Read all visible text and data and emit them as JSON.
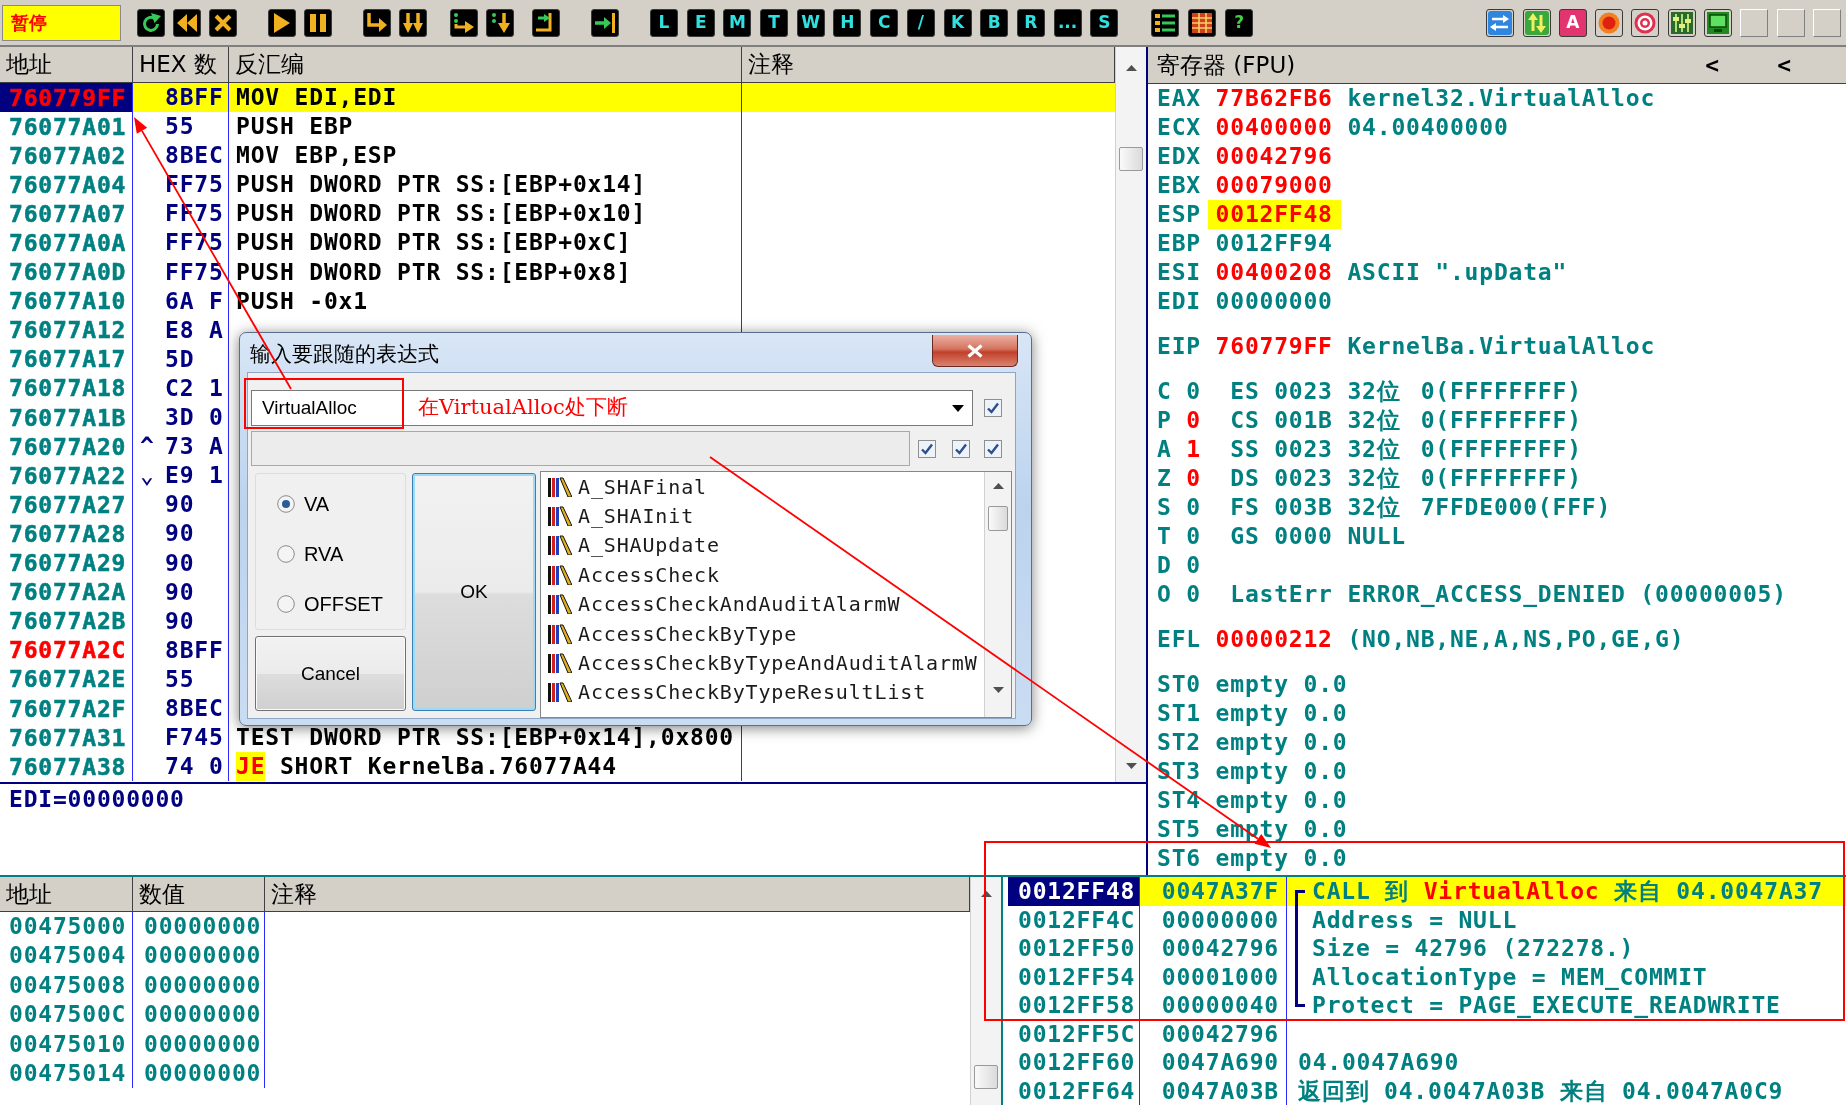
{
  "toolbar": {
    "status": "暂停",
    "letter_buttons": [
      "L",
      "E",
      "M",
      "T",
      "W",
      "H",
      "C",
      "/",
      "K",
      "B",
      "R",
      "...",
      "S"
    ],
    "help_button": "?",
    "text_button": "A"
  },
  "disassembly": {
    "columns": [
      "地址",
      "HEX 数",
      "反汇编",
      "注释"
    ],
    "rows": [
      {
        "address": "760779FF",
        "color": "#ff0000",
        "selected": true,
        "hex": "8BFF",
        "instruction": "MOV EDI,EDI"
      },
      {
        "address": "76077A01",
        "color": "#008080",
        "selected": false,
        "hex": "55",
        "instruction": "PUSH EBP"
      },
      {
        "address": "76077A02",
        "color": "#008080",
        "selected": false,
        "hex": "8BEC",
        "instruction": "MOV EBP,ESP"
      },
      {
        "address": "76077A04",
        "color": "#008080",
        "selected": false,
        "hex": "FF75",
        "instruction": "PUSH DWORD PTR SS:[EBP+0x14]"
      },
      {
        "address": "76077A07",
        "color": "#008080",
        "selected": false,
        "hex": "FF75",
        "instruction": "PUSH DWORD PTR SS:[EBP+0x10]"
      },
      {
        "address": "76077A0A",
        "color": "#008080",
        "selected": false,
        "hex": "FF75",
        "instruction": "PUSH DWORD PTR SS:[EBP+0xC]"
      },
      {
        "address": "76077A0D",
        "color": "#008080",
        "selected": false,
        "hex": "FF75",
        "instruction": "PUSH DWORD PTR SS:[EBP+0x8]"
      },
      {
        "address": "76077A10",
        "color": "#008080",
        "selected": false,
        "hex": "6A F",
        "instruction": "PUSH -0x1"
      },
      {
        "address": "76077A12",
        "color": "#008080",
        "selected": false,
        "hex": "E8 A"
      },
      {
        "address": "76077A17",
        "color": "#008080",
        "selected": false,
        "hex": "5D"
      },
      {
        "address": "76077A18",
        "color": "#008080",
        "selected": false,
        "hex": "C2 1"
      },
      {
        "address": "76077A1B",
        "color": "#008080",
        "selected": false,
        "hex": "3D 0"
      },
      {
        "address": "76077A20",
        "color": "#008080",
        "selected": false,
        "marker": "^",
        "hex": "73 A"
      },
      {
        "address": "76077A22",
        "color": "#008080",
        "selected": false,
        "marker": "⌄",
        "hex": "E9 1"
      },
      {
        "address": "76077A27",
        "color": "#008080",
        "selected": false,
        "hex": "90"
      },
      {
        "address": "76077A28",
        "color": "#008080",
        "selected": false,
        "hex": "90"
      },
      {
        "address": "76077A29",
        "color": "#008080",
        "selected": false,
        "hex": "90"
      },
      {
        "address": "76077A2A",
        "color": "#008080",
        "selected": false,
        "hex": "90"
      },
      {
        "address": "76077A2B",
        "color": "#008080",
        "selected": false,
        "hex": "90"
      },
      {
        "address": "76077A2C",
        "color": "#ff0000",
        "selected": false,
        "hex": "8BFF"
      },
      {
        "address": "76077A2E",
        "color": "#008080",
        "selected": false,
        "hex": "55"
      },
      {
        "address": "76077A2F",
        "color": "#008080",
        "selected": false,
        "hex": "8BEC"
      },
      {
        "address": "76077A31",
        "color": "#008080",
        "selected": false,
        "hex": "F745",
        "instruction": "TEST DWORD PTR SS:[EBP+0x14],0x800"
      },
      {
        "address": "76077A38",
        "color": "#008080",
        "selected": false,
        "hex": "74 0",
        "jump": "JE",
        "instruction": "SHORT KernelBa.76077A44"
      }
    ]
  },
  "info": "EDI=00000000",
  "registers": {
    "title": "寄存器 (FPU)",
    "nav": [
      "<",
      "<"
    ],
    "general": [
      {
        "name": "EAX",
        "value": "77B62FB6",
        "changed": true,
        "highlighted": false,
        "comment": "kernel32.VirtualAlloc"
      },
      {
        "name": "ECX",
        "value": "00400000",
        "changed": true,
        "highlighted": false,
        "comment": "04.00400000"
      },
      {
        "name": "EDX",
        "value": "00042796",
        "changed": true,
        "highlighted": false
      },
      {
        "name": "EBX",
        "value": "00079000",
        "changed": true,
        "highlighted": false
      },
      {
        "name": "ESP",
        "value": "0012FF48",
        "changed": true,
        "highlighted": true
      },
      {
        "name": "EBP",
        "value": "0012FF94",
        "changed": false,
        "highlighted": false
      },
      {
        "name": "ESI",
        "value": "00400208",
        "changed": true,
        "highlighted": false,
        "comment": "ASCII \".upData\""
      },
      {
        "name": "EDI",
        "value": "00000000",
        "changed": false,
        "highlighted": false
      }
    ],
    "eip": {
      "name": "EIP",
      "value": "760779FF",
      "changed": true,
      "highlighted": false,
      "comment": "KernelBa.VirtualAlloc"
    },
    "flags": [
      {
        "kind": "segment",
        "name": "C",
        "value": "0",
        "changed": false,
        "fields": [
          "ES",
          "0023",
          "32位",
          "0(FFFFFFFF)"
        ]
      },
      {
        "kind": "segment",
        "name": "P",
        "value": "0",
        "changed": true,
        "fields": [
          "CS",
          "001B",
          "32位",
          "0(FFFFFFFF)"
        ]
      },
      {
        "kind": "segment",
        "name": "A",
        "value": "1",
        "changed": true,
        "fields": [
          "SS",
          "0023",
          "32位",
          "0(FFFFFFFF)"
        ]
      },
      {
        "kind": "segment",
        "name": "Z",
        "value": "0",
        "changed": true,
        "fields": [
          "DS",
          "0023",
          "32位",
          "0(FFFFFFFF)"
        ]
      },
      {
        "kind": "segment",
        "name": "S",
        "value": "0",
        "changed": false,
        "fields": [
          "FS",
          "003B",
          "32位",
          "7FFDE000(FFF)"
        ]
      },
      {
        "kind": "segment",
        "name": "T",
        "value": "0",
        "changed": false,
        "fields": [
          "GS",
          "0000",
          "NULL"
        ]
      },
      {
        "kind": "plain",
        "name": "D",
        "value": "0",
        "changed": false
      },
      {
        "kind": "last_error",
        "name": "O",
        "value": "0",
        "changed": false,
        "fields": [
          "LastErr",
          "ERROR_ACCESS_DENIED (00000005)"
        ]
      }
    ],
    "efl": {
      "name": "EFL",
      "value": "00000212",
      "changed": true,
      "highlighted": false,
      "comment": "(NO,NB,NE,A,NS,PO,GE,G)"
    },
    "fpu": [
      {
        "name": "ST0",
        "tag": "empty",
        "value": "0.0"
      },
      {
        "name": "ST1",
        "tag": "empty",
        "value": "0.0"
      },
      {
        "name": "ST2",
        "tag": "empty",
        "value": "0.0"
      },
      {
        "name": "ST3",
        "tag": "empty",
        "value": "0.0"
      },
      {
        "name": "ST4",
        "tag": "empty",
        "value": "0.0"
      },
      {
        "name": "ST5",
        "tag": "empty",
        "value": "0.0"
      },
      {
        "name": "ST6",
        "tag": "empty",
        "value": "0.0"
      }
    ]
  },
  "dump": {
    "columns": [
      "地址",
      "数值",
      "注释"
    ],
    "rows": [
      {
        "address": "00475000",
        "value": "00000000"
      },
      {
        "address": "00475004",
        "value": "00000000"
      },
      {
        "address": "00475008",
        "value": "00000000"
      },
      {
        "address": "0047500C",
        "value": "00000000"
      },
      {
        "address": "00475010",
        "value": "00000000"
      },
      {
        "address": "00475014",
        "value": "00000000"
      }
    ]
  },
  "stack": {
    "rows": [
      {
        "address": "0012FF48",
        "value": "0047A37F",
        "selected": true,
        "kind": "call",
        "comment": "CALL 到",
        "callee": "VirtualAlloc",
        "caller": "来自 04.0047A37"
      },
      {
        "address": "0012FF4C",
        "value": "00000000",
        "selected": false,
        "kind": "argument",
        "comment": "Address = NULL"
      },
      {
        "address": "0012FF50",
        "value": "00042796",
        "selected": false,
        "kind": "argument",
        "comment": "Size = 42796 (272278.)"
      },
      {
        "address": "0012FF54",
        "value": "00001000",
        "selected": false,
        "kind": "argument",
        "comment": "AllocationType = MEM_COMMIT"
      },
      {
        "address": "0012FF58",
        "value": "00000040",
        "selected": false,
        "kind": "argument",
        "comment": "Protect = PAGE_EXECUTE_READWRITE"
      },
      {
        "address": "0012FF5C",
        "value": "00042796",
        "selected": false,
        "kind": "plain"
      },
      {
        "address": "0012FF60",
        "value": "0047A690",
        "selected": false,
        "kind": "plain",
        "comment": "04.0047A690"
      },
      {
        "address": "0012FF64",
        "value": "0047A03B",
        "selected": false,
        "kind": "plain",
        "comment": "返回到 04.0047A03B 来自 04.0047A0C9"
      }
    ]
  },
  "dialog": {
    "title": "输入要跟随的表达式",
    "expression": "VirtualAlloc",
    "options": [
      {
        "checked": true
      },
      {
        "checked": true
      },
      {
        "checked": true
      },
      {
        "checked": true
      }
    ],
    "modes": [
      {
        "label": "VA",
        "selected": true
      },
      {
        "label": "RVA",
        "selected": false
      },
      {
        "label": "OFFSET",
        "selected": false
      }
    ],
    "ok": "OK",
    "cancel": "Cancel",
    "symbols": [
      "A_SHAFinal",
      "A_SHAInit",
      "A_SHAUpdate",
      "AccessCheck",
      "AccessCheckAndAuditAlarmW",
      "AccessCheckByType",
      "AccessCheckByTypeAndAuditAlarmW",
      "AccessCheckByTypeResultList"
    ]
  },
  "annotation": {
    "note": "在VirtualAlloc处下断"
  }
}
